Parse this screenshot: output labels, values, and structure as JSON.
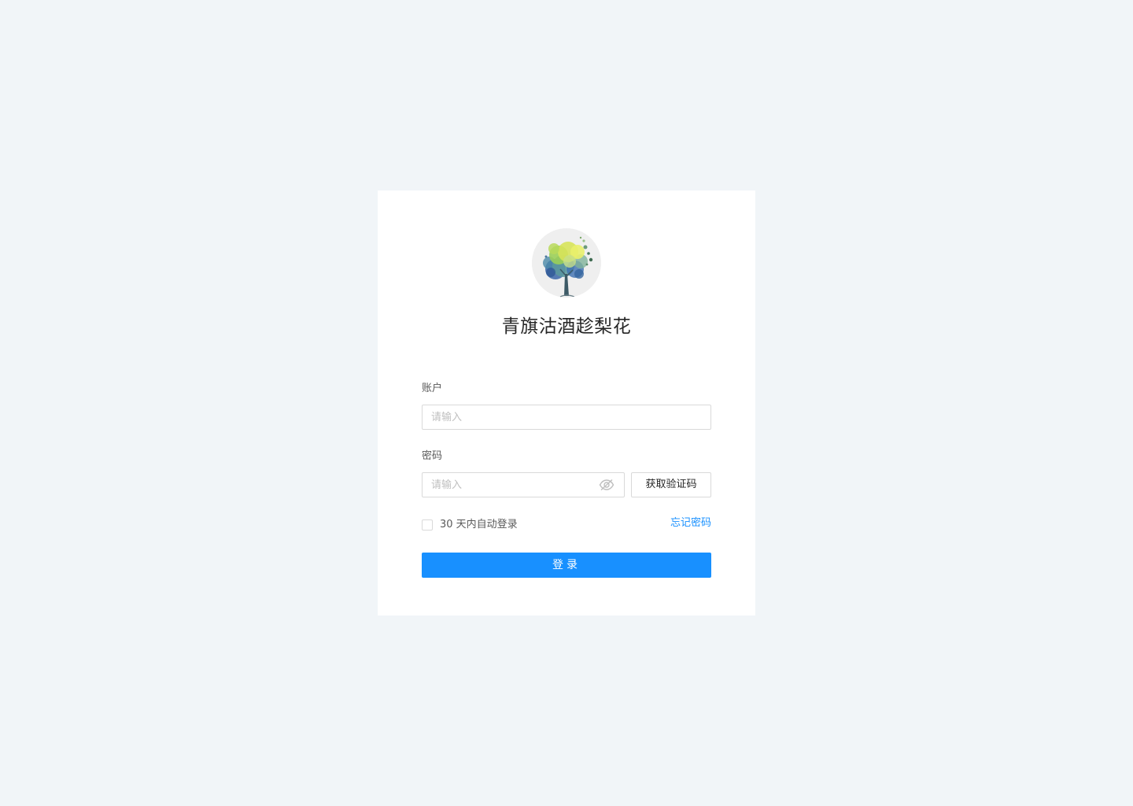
{
  "login": {
    "title": "青旗沽酒趁梨花",
    "account": {
      "label": "账户",
      "placeholder": "请输入",
      "value": ""
    },
    "password": {
      "label": "密码",
      "placeholder": "请输入",
      "value": "",
      "toggle_icon": "eye-hidden-icon"
    },
    "get_code_label": "获取验证码",
    "remember_label": "30 天内自动登录",
    "remember_checked": false,
    "forgot_label": "忘记密码",
    "submit_label": "登录"
  },
  "colors": {
    "background": "#f1f5f8",
    "card": "#ffffff",
    "primary": "#1890ff",
    "border": "#d9d9d9",
    "placeholder": "#bfbfbf",
    "text": "#262626",
    "label": "#595959"
  },
  "icons": {
    "avatar": "tree-watercolor-avatar",
    "password_toggle": "eye-hidden-icon"
  }
}
